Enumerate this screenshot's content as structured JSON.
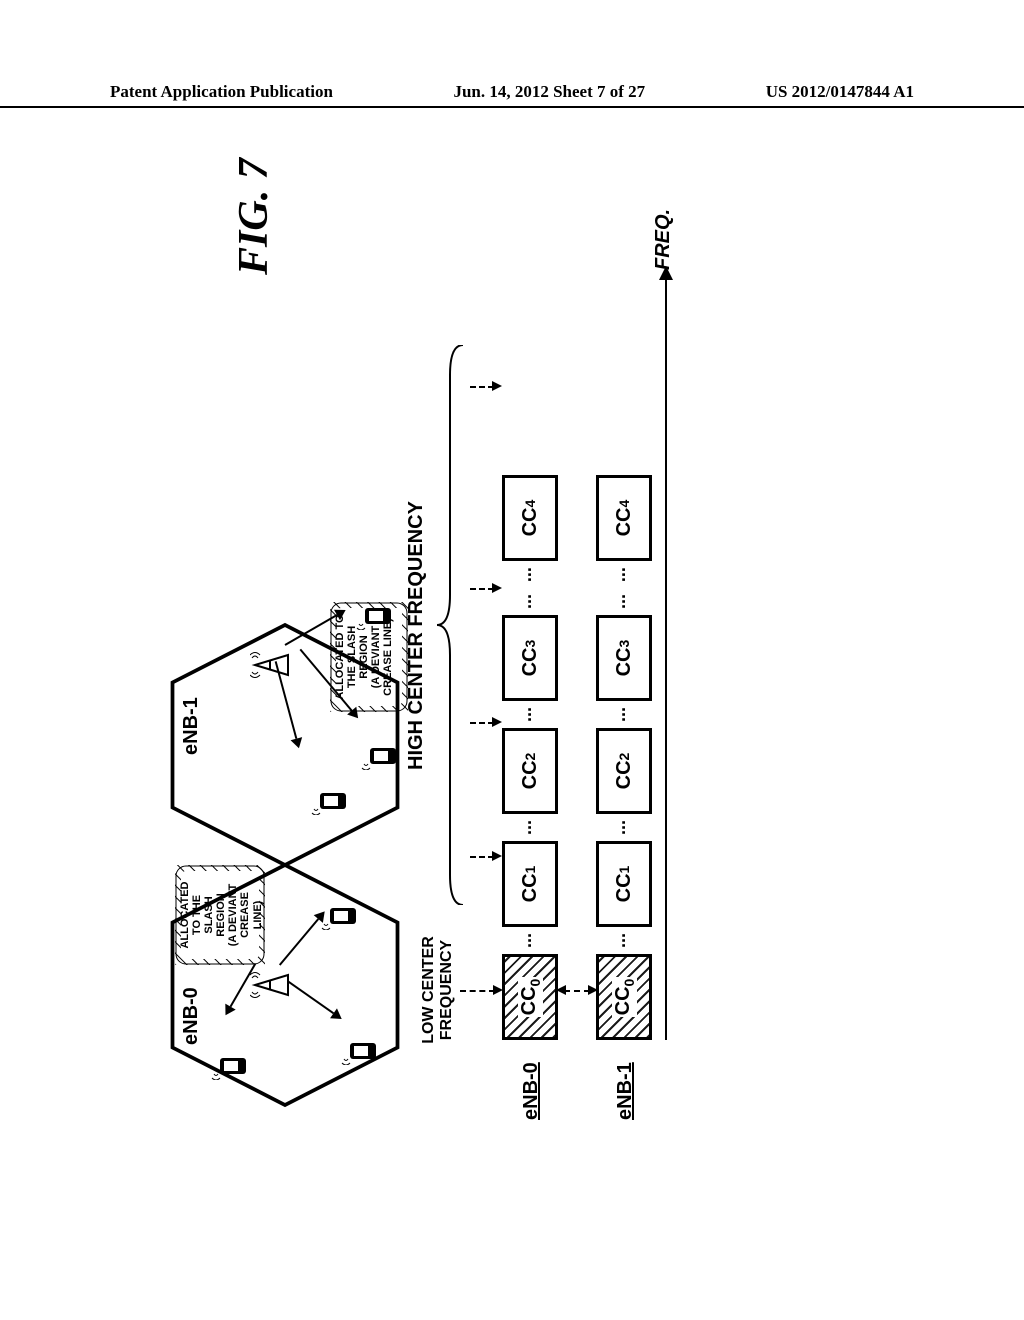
{
  "header": {
    "left": "Patent Application Publication",
    "center": "Jun. 14, 2012  Sheet 7 of 27",
    "right": "US 2012/0147844 A1"
  },
  "figure_title": "FIG. 7",
  "cells": {
    "cell0": {
      "label": "eNB-0",
      "note_lines": [
        "ALLOCATED",
        "TO THE",
        "SLASH",
        "REGION",
        "(A DEVIANT",
        "CREASE",
        "LINE)"
      ]
    },
    "cell1": {
      "label": "eNB-1",
      "note_lines": [
        "ALLOCATED TO",
        "THE SLASH",
        "REGION",
        "(A DEVIANT",
        "CREASE LINE)"
      ]
    }
  },
  "spectrum": {
    "row0_label": "eNB-0",
    "row1_label": "eNB-1",
    "low_center_label": "LOW CENTER\nFREQUENCY",
    "high_center_label": "HIGH CENTER FREQUENCY",
    "freq_axis_label": "FREQ.",
    "cc_labels": [
      "CC",
      "CC",
      "CC",
      "CC",
      "CC"
    ],
    "cc_subs": [
      "0",
      "1",
      "2",
      "3",
      "4"
    ]
  }
}
